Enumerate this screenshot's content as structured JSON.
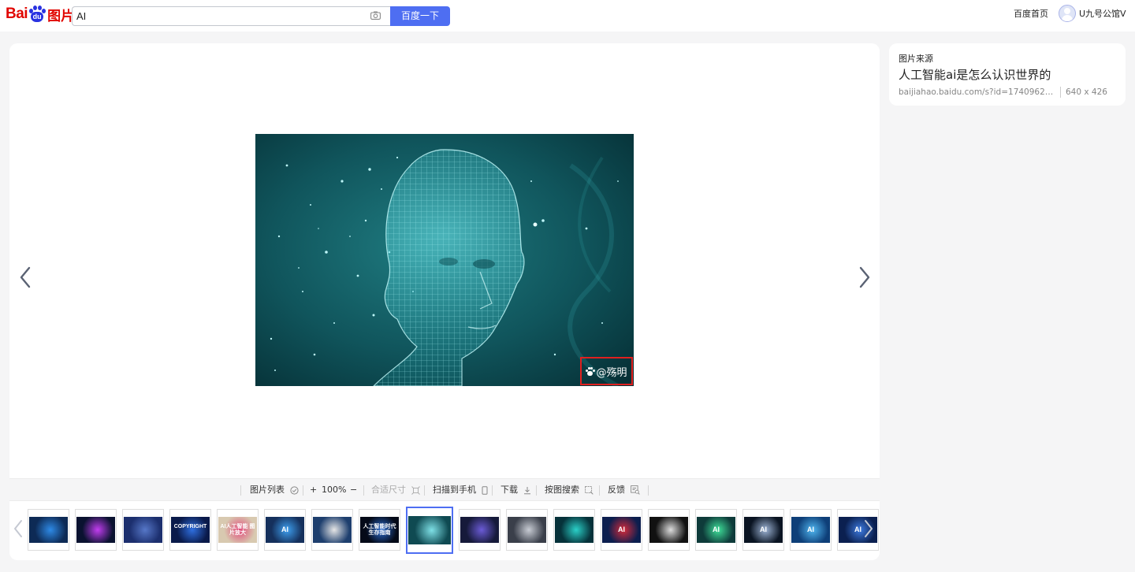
{
  "header": {
    "logo_text": "Bai",
    "logo_paw_text": "du",
    "logo_pic_text": "图片",
    "search_value": "AI",
    "search_button": "百度一下",
    "home_link": "百度首页",
    "user_name": "U九号公馆V"
  },
  "viewer": {
    "watermark": "@殇明"
  },
  "toolbar": {
    "image_list": "图片列表",
    "zoom_in": "+",
    "zoom_level": "100%",
    "zoom_out": "−",
    "fit_size": "合适尺寸",
    "scan_to_phone": "扫描到手机",
    "download": "下载",
    "search_by_image": "按图搜索",
    "feedback": "反馈"
  },
  "thumbnails": [
    {
      "bg": "#0d2a55",
      "accent": "#2e8ae6",
      "text": ""
    },
    {
      "bg": "#0a1230",
      "accent": "#c23df0",
      "text": ""
    },
    {
      "bg": "#1c2f6e",
      "accent": "#5677c8",
      "text": ""
    },
    {
      "bg": "#0a1a4a",
      "accent": "#2f6fe0",
      "text": "COPYRIGHT"
    },
    {
      "bg": "#d8c9b0",
      "accent": "#e14a7b",
      "text": "AI人工智能 图片放大"
    },
    {
      "bg": "#15305c",
      "accent": "#3ea0f0",
      "text": "AI"
    },
    {
      "bg": "#1e3f6e",
      "accent": "#e6e6e6",
      "text": ""
    },
    {
      "bg": "#050a18",
      "accent": "#2a6bd0",
      "text": "人工智能时代 生存指南"
    },
    {
      "bg": "#0f4a52",
      "accent": "#7ee0e6",
      "text": ""
    },
    {
      "bg": "#161a3a",
      "accent": "#6b5bd6",
      "text": ""
    },
    {
      "bg": "#3a3f4a",
      "accent": "#c8ccd4",
      "text": ""
    },
    {
      "bg": "#06323a",
      "accent": "#2ad0c8",
      "text": ""
    },
    {
      "bg": "#0c1e4e",
      "accent": "#d62a3a",
      "text": "AI"
    },
    {
      "bg": "#111111",
      "accent": "#dddddd",
      "text": ""
    },
    {
      "bg": "#0e3b3a",
      "accent": "#3fe09a",
      "text": "AI"
    },
    {
      "bg": "#0a1422",
      "accent": "#9fb6d8",
      "text": "AI"
    },
    {
      "bg": "#0e3f78",
      "accent": "#4fb6f0",
      "text": "AI"
    },
    {
      "bg": "#0b2050",
      "accent": "#3d7be0",
      "text": "AI"
    }
  ],
  "source": {
    "label": "图片来源",
    "title": "人工智能ai是怎么认识世界的",
    "url": "baijiahao.baidu.com/s?id=17409629892...",
    "size": "640 x 426"
  }
}
